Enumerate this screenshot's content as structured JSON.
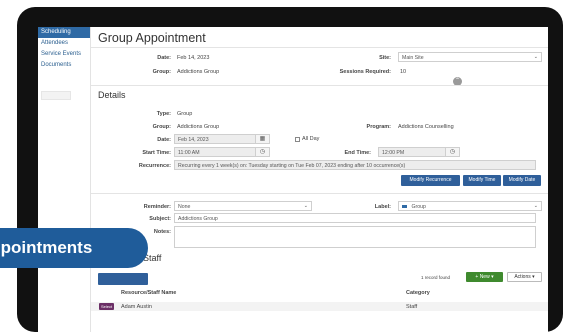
{
  "sidebar": {
    "items": [
      {
        "label": "Scheduling"
      },
      {
        "label": "Attendees"
      },
      {
        "label": "Service Events"
      },
      {
        "label": "Documents"
      }
    ]
  },
  "page": {
    "title": "Group Appointment"
  },
  "summary": {
    "date_label": "Date:",
    "date_value": "Feb 14, 2023",
    "group_label": "Group:",
    "group_value": "Addictions Group",
    "site_label": "Site:",
    "site_value": "Main Site",
    "sessions_label": "Sessions Required:",
    "sessions_value": "10"
  },
  "details": {
    "title": "Details",
    "type_label": "Type:",
    "type_value": "Group",
    "group_label": "Group:",
    "group_value": "Addictions Group",
    "program_label": "Program:",
    "program_value": "Addictions Counselling",
    "date_label": "Date:",
    "date_value": "Feb 14, 2023",
    "allday_label": "All Day",
    "start_label": "Start Time:",
    "start_value": "11:00 AM",
    "end_label": "End Time:",
    "end_value": "12:00 PM",
    "recurrence_label": "Recurrence:",
    "recurrence_value": "Recurring every 1 week(s) on: Tuesday starting on Tue Feb 07, 2023 ending after 10 occurrence(s)",
    "btn_modify_recurrence": "Modify Recurrence",
    "btn_modify_time": "Modify Time",
    "btn_modify_date": "Modify Date",
    "reminder_label": "Reminder:",
    "reminder_value": "None",
    "label_label": "Label:",
    "label_value": "Group",
    "subject_label": "Subject:",
    "subject_value": "Addictions Group",
    "notes_label": "Notes:"
  },
  "staff": {
    "title": "Staff",
    "record_count": "1 record found",
    "new_button": "+ New",
    "actions_button": "Actions",
    "col_resource": "Resource/Staff Name",
    "col_category": "Category",
    "rows": [
      {
        "tag": "Select",
        "name": "Adam Austin",
        "category": "Staff"
      }
    ]
  },
  "overlay": {
    "badge": "Appointments"
  },
  "colors": {
    "accent": "#2f5f9a",
    "badge": "#1f5c9a",
    "new": "#3f8a2e",
    "tag": "#6b2f66"
  }
}
